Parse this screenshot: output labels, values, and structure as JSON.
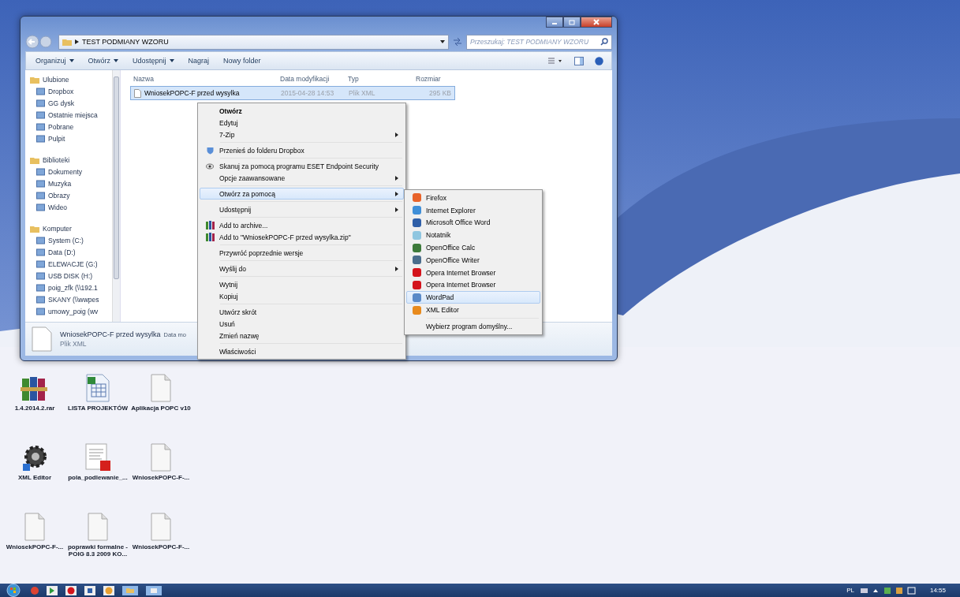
{
  "window": {
    "breadcrumb": "TEST PODMIANY WZORU",
    "search": {
      "placeholder": "Przeszukaj: TEST PODMIANY WZORU"
    },
    "toolbar": [
      {
        "label": "Organizuj",
        "dropdown": true
      },
      {
        "label": "Otwórz",
        "dropdown": true
      },
      {
        "label": "Udostępnij",
        "dropdown": true
      },
      {
        "label": "Nagraj",
        "dropdown": false
      },
      {
        "label": "Nowy folder",
        "dropdown": false
      }
    ],
    "sidebar": [
      {
        "label": "Ulubione",
        "children": [
          {
            "label": "Dropbox"
          },
          {
            "label": "GG dysk"
          },
          {
            "label": "Ostatnie miejsca"
          },
          {
            "label": "Pobrane"
          },
          {
            "label": "Pulpit"
          }
        ]
      },
      {
        "label": "Biblioteki",
        "children": [
          {
            "label": "Dokumenty"
          },
          {
            "label": "Muzyka"
          },
          {
            "label": "Obrazy"
          },
          {
            "label": "Wideo"
          }
        ]
      },
      {
        "label": "Komputer",
        "children": [
          {
            "label": "System (C:)"
          },
          {
            "label": "Data (D:)"
          },
          {
            "label": "ELEWACJE (G:)"
          },
          {
            "label": "USB DISK (H:)"
          },
          {
            "label": "poig_zfk (\\\\192.1"
          },
          {
            "label": "SKANY (\\\\wwpes"
          },
          {
            "label": "umowy_poig (wv"
          }
        ]
      }
    ],
    "columns": [
      "Nazwa",
      "Data modyfikacji",
      "Typ",
      "Rozmiar"
    ],
    "rows": [
      {
        "name": "WniosekPOPC-F przed wysylka",
        "date": "2015-04-28 14:53",
        "type": "Plik XML",
        "size": "295 KB",
        "selected": true
      }
    ],
    "details": {
      "name": "WniosekPOPC-F przed wysylka",
      "meta": "Data mo",
      "type": "Plik XML"
    }
  },
  "context_menu": [
    [
      {
        "label": "Otwórz",
        "bold": true,
        "submenu": false,
        "selected": false
      },
      {
        "label": "Edytuj",
        "bold": false,
        "submenu": false,
        "selected": false
      },
      {
        "label": "7-Zip",
        "bold": false,
        "submenu": true,
        "selected": false
      }
    ],
    [
      {
        "label": "Przenieś do folderu Dropbox",
        "bold": false,
        "submenu": false,
        "selected": false,
        "kind": "dropbox"
      }
    ],
    [
      {
        "label": "Skanuj za pomocą programu ESET Endpoint Security",
        "bold": false,
        "submenu": false,
        "selected": false,
        "kind": "scan"
      },
      {
        "label": "Opcje zaawansowane",
        "bold": false,
        "submenu": true,
        "selected": false
      }
    ],
    [
      {
        "label": "Otwórz za pomocą",
        "bold": false,
        "submenu": true,
        "selected": true
      }
    ],
    [
      {
        "label": "Udostępnij",
        "bold": false,
        "submenu": true,
        "selected": false
      }
    ],
    [
      {
        "label": "Add to archive...",
        "bold": false,
        "submenu": false,
        "selected": false,
        "kind": "archive"
      },
      {
        "label": "Add to \"WniosekPOPC-F przed wysylka.zip\"",
        "bold": false,
        "submenu": false,
        "selected": false,
        "kind": "archive"
      }
    ],
    [
      {
        "label": "Przywróć poprzednie wersje",
        "bold": false,
        "submenu": false,
        "selected": false
      }
    ],
    [
      {
        "label": "Wyślij do",
        "bold": false,
        "submenu": true,
        "selected": false
      }
    ],
    [
      {
        "label": "Wytnij",
        "bold": false,
        "submenu": false,
        "selected": false
      },
      {
        "label": "Kopiuj",
        "bold": false,
        "submenu": false,
        "selected": false
      }
    ],
    [
      {
        "label": "Utwórz skrót",
        "bold": false,
        "submenu": false,
        "selected": false
      },
      {
        "label": "Usuń",
        "bold": false,
        "submenu": false,
        "selected": false
      },
      {
        "label": "Zmień nazwę",
        "bold": false,
        "submenu": false,
        "selected": false
      }
    ],
    [
      {
        "label": "Właściwości",
        "bold": false,
        "submenu": false,
        "selected": false
      }
    ]
  ],
  "open_with": [
    [
      {
        "label": "Firefox",
        "color": "#e8632a",
        "selected": false
      },
      {
        "label": "Internet Explorer",
        "color": "#3f8fd8",
        "selected": false
      },
      {
        "label": "Microsoft Office Word",
        "color": "#2f5fa8",
        "selected": false
      },
      {
        "label": "Notatnik",
        "color": "#8fc6e0",
        "selected": false
      },
      {
        "label": "OpenOffice Calc",
        "color": "#3d7a3a",
        "selected": false
      },
      {
        "label": "OpenOffice Writer",
        "color": "#4a6d8c",
        "selected": false
      },
      {
        "label": "Opera Internet Browser",
        "color": "#d4141c",
        "selected": false
      },
      {
        "label": "Opera Internet Browser",
        "color": "#d4141c",
        "selected": false
      },
      {
        "label": "WordPad",
        "color": "#5a8ac8",
        "selected": true
      },
      {
        "label": "XML Editor",
        "color": "#e88a1c",
        "selected": false
      }
    ],
    [
      {
        "label": "Wybierz program domyślny...",
        "selected": false
      }
    ]
  ],
  "desktop_icons": [
    {
      "label": "1.4.2014.2.rar",
      "kind": "archive"
    },
    {
      "label": "LISTA PROJEKTÓW",
      "kind": "sheet"
    },
    {
      "label": "Aplikacja POPC v10",
      "kind": "doc"
    },
    {
      "label": "XML Editor",
      "kind": "gear"
    },
    {
      "label": "pola_podlewanie_...",
      "kind": "pdf"
    },
    {
      "label": "WniosekPOPC-F-...",
      "kind": "doc"
    },
    {
      "label": "WniosekPOPC-F-...",
      "kind": "doc"
    },
    {
      "label": "poprawki formalne - POIG 8.3 2009 KO...",
      "kind": "doc"
    },
    {
      "label": "WniosekPOPC-F-...",
      "kind": "doc"
    }
  ],
  "taskbar": {
    "language": "PL",
    "clock": "14:55"
  }
}
